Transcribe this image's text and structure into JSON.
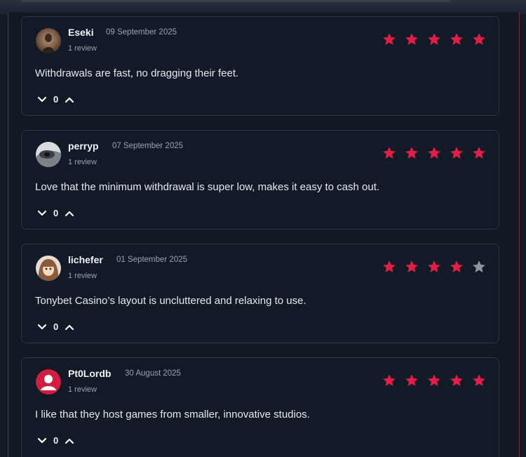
{
  "colors": {
    "star_filled": "#e11d48",
    "star_empty": "#8e959e",
    "card_border": "#2c3645",
    "panel_edge": "#7a2438"
  },
  "reviews": [
    {
      "username": "Eseki",
      "date": "09 September 2025",
      "review_count": "1 review",
      "rating": 5,
      "text": "Withdrawals are fast, no dragging their feet.",
      "votes": "0",
      "avatar": "eseki-avatar-photo"
    },
    {
      "username": "perryp",
      "date": "07 September 2025",
      "review_count": "1 review",
      "rating": 5,
      "text": "Love that the minimum withdrawal is super low, makes it easy to cash out.",
      "votes": "0",
      "avatar": "perryp-avatar-photo"
    },
    {
      "username": "lichefer",
      "date": "01 September 2025",
      "review_count": "1 review",
      "rating": 4,
      "text": "Tonybet Casino’s layout is uncluttered and relaxing to use.",
      "votes": "0",
      "avatar": "lichefer-avatar-photo"
    },
    {
      "username": "Pt0Lordb",
      "date": "30 August 2025",
      "review_count": "1 review",
      "rating": 5,
      "text": "I like that they host games from smaller, innovative studios.",
      "votes": "0",
      "avatar": "default-user-avatar"
    }
  ]
}
